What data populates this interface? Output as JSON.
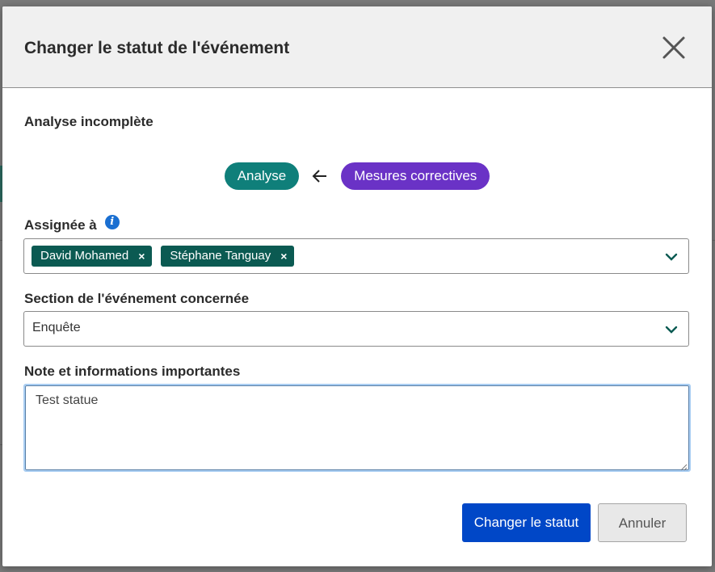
{
  "modal": {
    "title": "Changer le statut de l'événement",
    "close_icon": "close-icon"
  },
  "status": {
    "heading": "Analyse incomplète",
    "from_label": "Analyse",
    "arrow_icon": "arrow-left-icon",
    "to_label": "Mesures correctives",
    "from_color": "#0f7f7a",
    "to_color": "#6a32c6"
  },
  "assignee": {
    "label": "Assignée à",
    "info_icon": "info-icon",
    "chips": [
      {
        "name": "David Mohamed",
        "remove": "×"
      },
      {
        "name": "Stéphane Tanguay",
        "remove": "×"
      }
    ],
    "chip_color": "#0b5a52"
  },
  "section": {
    "label": "Section de l'événement concernée",
    "selected": "Enquête"
  },
  "note": {
    "label": "Note et informations importantes",
    "value": "Test statue"
  },
  "actions": {
    "primary_label": "Changer le statut",
    "secondary_label": "Annuler",
    "primary_color": "#0047c7"
  }
}
